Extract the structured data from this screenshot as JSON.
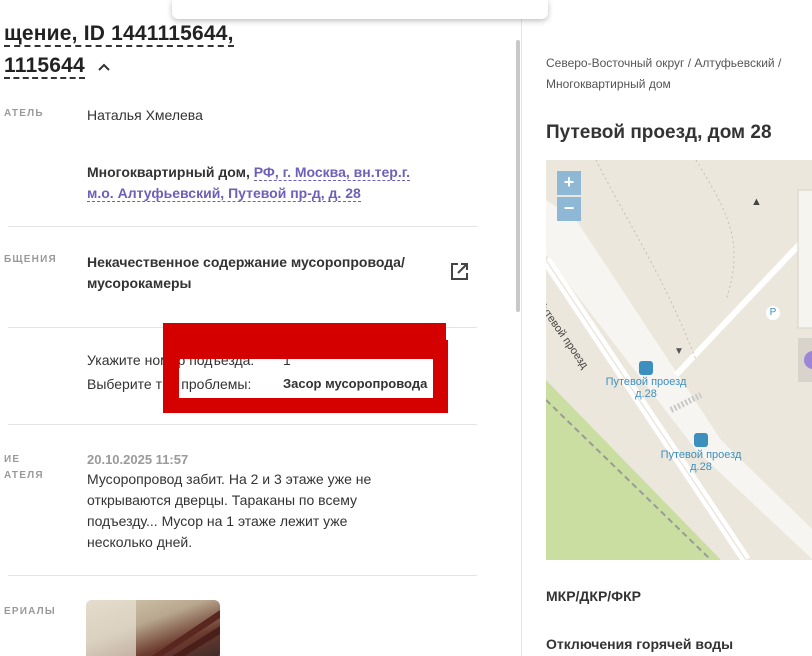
{
  "header": {
    "title_line1": "щение, ID 1441115644,",
    "title_line2": "1115644"
  },
  "fields": {
    "applicant_label": "АТЕЛЬ",
    "applicant_value": "Наталья Хмелева",
    "object_type": "Многоквартирный дом,",
    "object_address": "РФ, г. Москва, вн.тер.г. м.о. Алтуфьевский, Путевой пр-д, д. 28",
    "topic_label": "БЩЕНИЯ",
    "topic_value": "Некачественное содержание мусоропровода/ мусорокамеры",
    "param1_label": "Укажите номер подъезда:",
    "param1_value": "1",
    "param2_label": "Выберите тип проблемы:",
    "param2_value": "Засор мусоропровода",
    "message_label": "ИЕ\nАТЕЛЯ",
    "message_date": "20.10.2025 11:57",
    "message_text": "Мусоропровод забит. На 2 и 3 этаже уже не открываются дверцы. Тараканы по всему подъезду... Мусор на 1 этаже лежит уже несколько дней.",
    "materials_label": "ЕРИАЛЫ"
  },
  "right_panel": {
    "breadcrumb": "Северо-Восточный округ / Алтуфьевский / Многоквартирный дом",
    "address_title": "Путевой проезд, дом 28",
    "map": {
      "zoom_in": "+",
      "zoom_out": "−",
      "street_label": "Путевой проезд",
      "stop1": "Путевой проезд д.28",
      "stop2": "Путевой проезд д.28",
      "parking": "P"
    },
    "section1": "МКР/ДКР/ФКР",
    "section2": "Отключения горячей воды"
  },
  "colors": {
    "redaction": "#d40000",
    "link": "#6e60b8",
    "map_bg": "#ece7dc",
    "park": "#c9dea0",
    "road": "#ffffff"
  }
}
